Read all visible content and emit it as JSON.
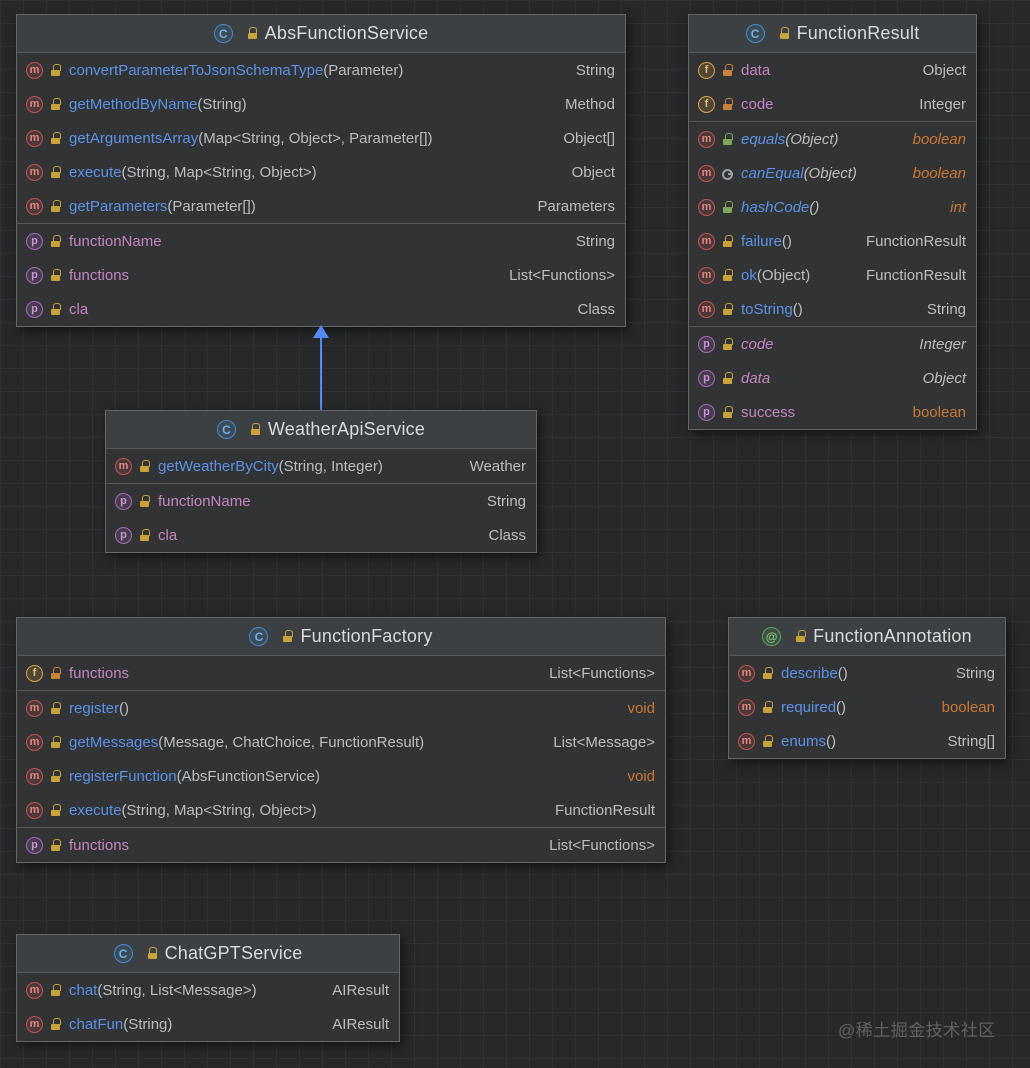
{
  "watermark": "@稀土掘金技术社区",
  "colors": {
    "background": "#27282a",
    "grid_line": "#2f3133",
    "box_header": "#3d4042",
    "box_body": "#313335",
    "box_border": "#63666a",
    "method_name": "#5c92e8",
    "property_name": "#c586c0",
    "primitive_type": "#cc7832",
    "plain_text": "#bdbdbd",
    "inheritance_arrow": "#548af7"
  },
  "icons": {
    "class_icon": "blue-circle-C",
    "annotation_icon": "green-circle-@",
    "method_icon": "red-circle-m",
    "field_icon": "orange-circle-f",
    "property_icon": "purple-circle-p",
    "private_icon": "lock",
    "protected_icon": "key"
  },
  "classes": {
    "abs": {
      "title": "AbsFunctionService",
      "methods": [
        {
          "name": "convertParameterToJsonSchemaType",
          "params": "(Parameter)",
          "type": "String"
        },
        {
          "name": "getMethodByName",
          "params": "(String)",
          "type": "Method"
        },
        {
          "name": "getArgumentsArray",
          "params": "(Map<String, Object>, Parameter[])",
          "type": "Object[]"
        },
        {
          "name": "execute",
          "params": "(String, Map<String, Object>)",
          "type": "Object"
        },
        {
          "name": "getParameters",
          "params": "(Parameter[])",
          "type": "Parameters"
        }
      ],
      "properties": [
        {
          "name": "functionName",
          "type": "String"
        },
        {
          "name": "functions",
          "type": "List<Functions>"
        },
        {
          "name": "cla",
          "type": "Class"
        }
      ]
    },
    "result": {
      "title": "FunctionResult",
      "fields": [
        {
          "name": "data",
          "type": "Object"
        },
        {
          "name": "code",
          "type": "Integer"
        }
      ],
      "methods": [
        {
          "name": "equals",
          "params": "(Object)",
          "type": "boolean"
        },
        {
          "name": "canEqual",
          "params": "(Object)",
          "type": "boolean"
        },
        {
          "name": "hashCode",
          "params": "()",
          "type": "int"
        },
        {
          "name": "failure",
          "params": "()",
          "type": "FunctionResult"
        },
        {
          "name": "ok",
          "params": "(Object)",
          "type": "FunctionResult"
        },
        {
          "name": "toString",
          "params": "()",
          "type": "String"
        }
      ],
      "properties": [
        {
          "name": "code",
          "type": "Integer"
        },
        {
          "name": "data",
          "type": "Object"
        },
        {
          "name": "success",
          "type": "boolean"
        }
      ]
    },
    "weather": {
      "title": "WeatherApiService",
      "methods": [
        {
          "name": "getWeatherByCity",
          "params": "(String, Integer)",
          "type": "Weather"
        }
      ],
      "properties": [
        {
          "name": "functionName",
          "type": "String"
        },
        {
          "name": "cla",
          "type": "Class"
        }
      ]
    },
    "factory": {
      "title": "FunctionFactory",
      "fields": [
        {
          "name": "functions",
          "type": "List<Functions>"
        }
      ],
      "methods": [
        {
          "name": "register",
          "params": "()",
          "type": "void"
        },
        {
          "name": "getMessages",
          "params": "(Message, ChatChoice, FunctionResult)",
          "type": "List<Message>"
        },
        {
          "name": "registerFunction",
          "params": "(AbsFunctionService)",
          "type": "void"
        },
        {
          "name": "execute",
          "params": "(String, Map<String, Object>)",
          "type": "FunctionResult"
        }
      ],
      "properties": [
        {
          "name": "functions",
          "type": "List<Functions>"
        }
      ]
    },
    "annotation": {
      "title": "FunctionAnnotation",
      "methods": [
        {
          "name": "describe",
          "params": "()",
          "type": "String"
        },
        {
          "name": "required",
          "params": "()",
          "type": "boolean"
        },
        {
          "name": "enums",
          "params": "()",
          "type": "String[]"
        }
      ]
    },
    "chat": {
      "title": "ChatGPTService",
      "methods": [
        {
          "name": "chat",
          "params": "(String, List<Message>)",
          "type": "AIResult"
        },
        {
          "name": "chatFun",
          "params": "(String)",
          "type": "AIResult"
        }
      ]
    }
  }
}
